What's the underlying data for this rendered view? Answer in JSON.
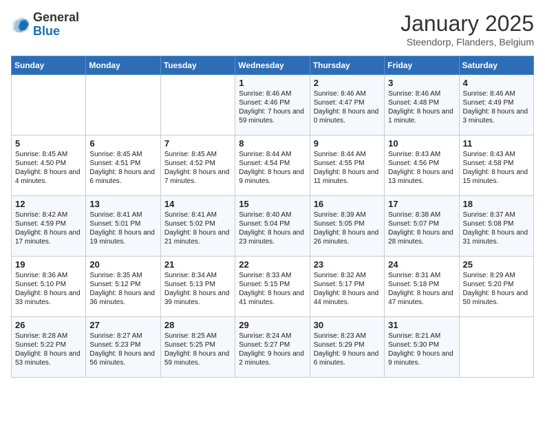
{
  "header": {
    "logo_general": "General",
    "logo_blue": "Blue",
    "month_title": "January 2025",
    "subtitle": "Steendorp, Flanders, Belgium"
  },
  "days_of_week": [
    "Sunday",
    "Monday",
    "Tuesday",
    "Wednesday",
    "Thursday",
    "Friday",
    "Saturday"
  ],
  "weeks": [
    [
      {
        "day": "",
        "info": ""
      },
      {
        "day": "",
        "info": ""
      },
      {
        "day": "",
        "info": ""
      },
      {
        "day": "1",
        "info": "Sunrise: 8:46 AM\nSunset: 4:46 PM\nDaylight: 7 hours and 59 minutes."
      },
      {
        "day": "2",
        "info": "Sunrise: 8:46 AM\nSunset: 4:47 PM\nDaylight: 8 hours and 0 minutes."
      },
      {
        "day": "3",
        "info": "Sunrise: 8:46 AM\nSunset: 4:48 PM\nDaylight: 8 hours and 1 minute."
      },
      {
        "day": "4",
        "info": "Sunrise: 8:46 AM\nSunset: 4:49 PM\nDaylight: 8 hours and 3 minutes."
      }
    ],
    [
      {
        "day": "5",
        "info": "Sunrise: 8:45 AM\nSunset: 4:50 PM\nDaylight: 8 hours and 4 minutes."
      },
      {
        "day": "6",
        "info": "Sunrise: 8:45 AM\nSunset: 4:51 PM\nDaylight: 8 hours and 6 minutes."
      },
      {
        "day": "7",
        "info": "Sunrise: 8:45 AM\nSunset: 4:52 PM\nDaylight: 8 hours and 7 minutes."
      },
      {
        "day": "8",
        "info": "Sunrise: 8:44 AM\nSunset: 4:54 PM\nDaylight: 8 hours and 9 minutes."
      },
      {
        "day": "9",
        "info": "Sunrise: 8:44 AM\nSunset: 4:55 PM\nDaylight: 8 hours and 11 minutes."
      },
      {
        "day": "10",
        "info": "Sunrise: 8:43 AM\nSunset: 4:56 PM\nDaylight: 8 hours and 13 minutes."
      },
      {
        "day": "11",
        "info": "Sunrise: 8:43 AM\nSunset: 4:58 PM\nDaylight: 8 hours and 15 minutes."
      }
    ],
    [
      {
        "day": "12",
        "info": "Sunrise: 8:42 AM\nSunset: 4:59 PM\nDaylight: 8 hours and 17 minutes."
      },
      {
        "day": "13",
        "info": "Sunrise: 8:41 AM\nSunset: 5:01 PM\nDaylight: 8 hours and 19 minutes."
      },
      {
        "day": "14",
        "info": "Sunrise: 8:41 AM\nSunset: 5:02 PM\nDaylight: 8 hours and 21 minutes."
      },
      {
        "day": "15",
        "info": "Sunrise: 8:40 AM\nSunset: 5:04 PM\nDaylight: 8 hours and 23 minutes."
      },
      {
        "day": "16",
        "info": "Sunrise: 8:39 AM\nSunset: 5:05 PM\nDaylight: 8 hours and 26 minutes."
      },
      {
        "day": "17",
        "info": "Sunrise: 8:38 AM\nSunset: 5:07 PM\nDaylight: 8 hours and 28 minutes."
      },
      {
        "day": "18",
        "info": "Sunrise: 8:37 AM\nSunset: 5:08 PM\nDaylight: 8 hours and 31 minutes."
      }
    ],
    [
      {
        "day": "19",
        "info": "Sunrise: 8:36 AM\nSunset: 5:10 PM\nDaylight: 8 hours and 33 minutes."
      },
      {
        "day": "20",
        "info": "Sunrise: 8:35 AM\nSunset: 5:12 PM\nDaylight: 8 hours and 36 minutes."
      },
      {
        "day": "21",
        "info": "Sunrise: 8:34 AM\nSunset: 5:13 PM\nDaylight: 8 hours and 39 minutes."
      },
      {
        "day": "22",
        "info": "Sunrise: 8:33 AM\nSunset: 5:15 PM\nDaylight: 8 hours and 41 minutes."
      },
      {
        "day": "23",
        "info": "Sunrise: 8:32 AM\nSunset: 5:17 PM\nDaylight: 8 hours and 44 minutes."
      },
      {
        "day": "24",
        "info": "Sunrise: 8:31 AM\nSunset: 5:18 PM\nDaylight: 8 hours and 47 minutes."
      },
      {
        "day": "25",
        "info": "Sunrise: 8:29 AM\nSunset: 5:20 PM\nDaylight: 8 hours and 50 minutes."
      }
    ],
    [
      {
        "day": "26",
        "info": "Sunrise: 8:28 AM\nSunset: 5:22 PM\nDaylight: 8 hours and 53 minutes."
      },
      {
        "day": "27",
        "info": "Sunrise: 8:27 AM\nSunset: 5:23 PM\nDaylight: 8 hours and 56 minutes."
      },
      {
        "day": "28",
        "info": "Sunrise: 8:25 AM\nSunset: 5:25 PM\nDaylight: 8 hours and 59 minutes."
      },
      {
        "day": "29",
        "info": "Sunrise: 8:24 AM\nSunset: 5:27 PM\nDaylight: 9 hours and 2 minutes."
      },
      {
        "day": "30",
        "info": "Sunrise: 8:23 AM\nSunset: 5:29 PM\nDaylight: 9 hours and 6 minutes."
      },
      {
        "day": "31",
        "info": "Sunrise: 8:21 AM\nSunset: 5:30 PM\nDaylight: 9 hours and 9 minutes."
      },
      {
        "day": "",
        "info": ""
      }
    ]
  ]
}
